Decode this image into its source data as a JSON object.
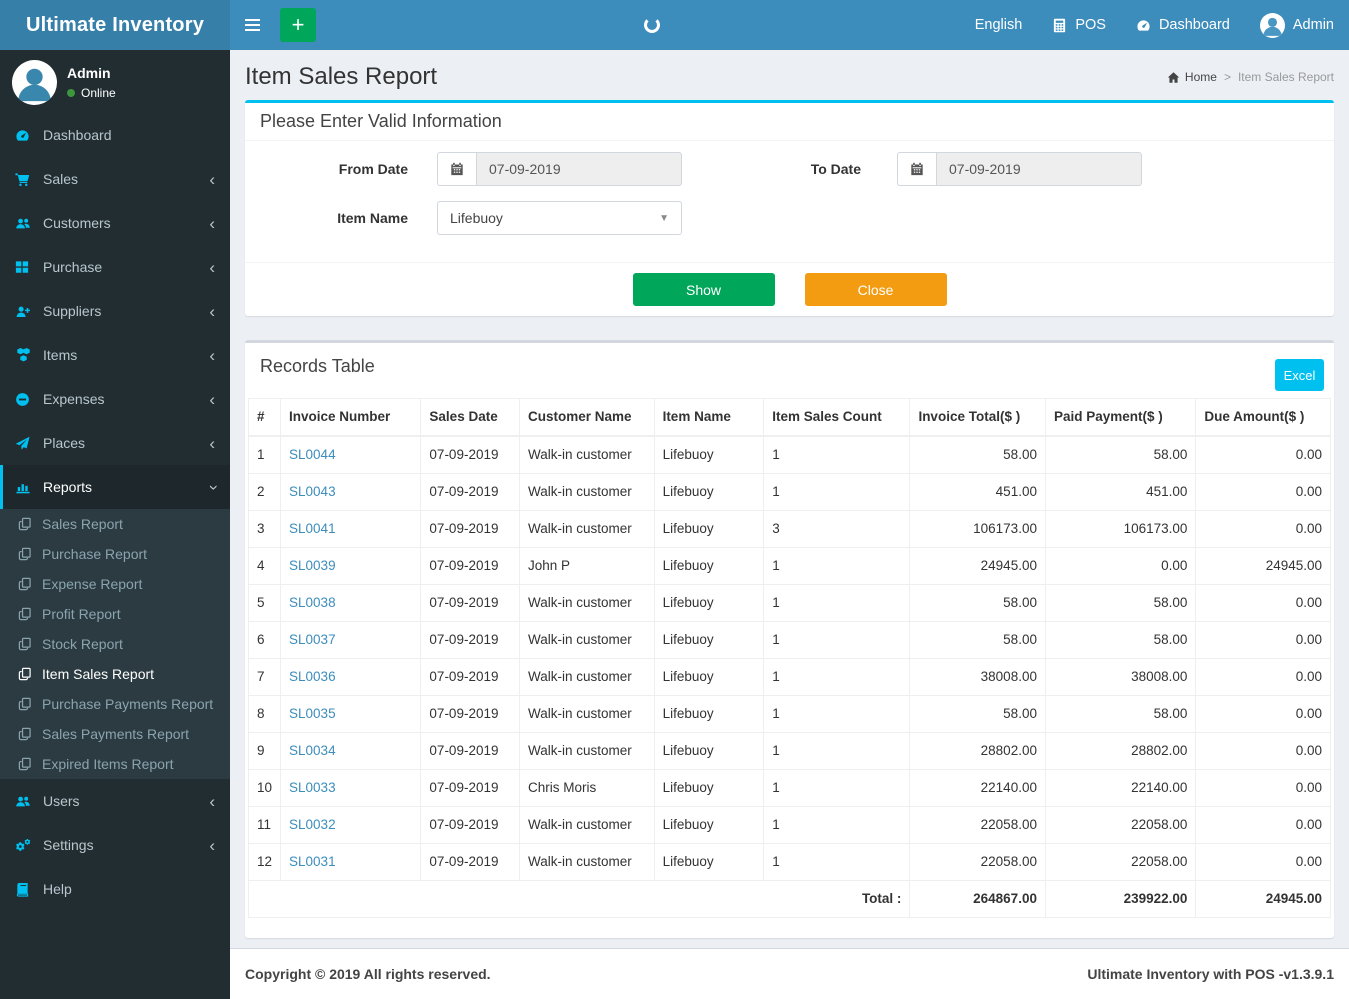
{
  "app": {
    "title": "Ultimate Inventory"
  },
  "topnav": {
    "add_button": "+",
    "links": [
      {
        "id": "language",
        "label": "English",
        "icon": null
      },
      {
        "id": "pos",
        "label": "POS",
        "icon": "calculator"
      },
      {
        "id": "dashboard",
        "label": "Dashboard",
        "icon": "speedometer"
      },
      {
        "id": "admin",
        "label": "Admin",
        "icon": "avatar"
      }
    ]
  },
  "sidebar": {
    "user": {
      "name": "Admin",
      "status": "Online"
    },
    "menu": [
      {
        "label": "Dashboard",
        "icon": "speedometer",
        "expandable": false
      },
      {
        "label": "Sales",
        "icon": "cart",
        "expandable": true
      },
      {
        "label": "Customers",
        "icon": "users",
        "expandable": true
      },
      {
        "label": "Purchase",
        "icon": "grid",
        "expandable": true
      },
      {
        "label": "Suppliers",
        "icon": "user-plus",
        "expandable": true
      },
      {
        "label": "Items",
        "icon": "cubes",
        "expandable": true
      },
      {
        "label": "Expenses",
        "icon": "minus-circle",
        "expandable": true
      },
      {
        "label": "Places",
        "icon": "paper-plane",
        "expandable": true
      },
      {
        "label": "Reports",
        "icon": "bar-chart",
        "expandable": true,
        "expanded": true,
        "active": true,
        "submenu": [
          {
            "label": "Sales Report"
          },
          {
            "label": "Purchase Report"
          },
          {
            "label": "Expense Report"
          },
          {
            "label": "Profit Report"
          },
          {
            "label": "Stock Report"
          },
          {
            "label": "Item Sales Report",
            "active": true
          },
          {
            "label": "Purchase Payments Report"
          },
          {
            "label": "Sales Payments Report"
          },
          {
            "label": "Expired Items Report"
          }
        ]
      },
      {
        "label": "Users",
        "icon": "users",
        "expandable": true
      },
      {
        "label": "Settings",
        "icon": "gears",
        "expandable": true
      },
      {
        "label": "Help",
        "icon": "book",
        "expandable": false
      }
    ]
  },
  "page": {
    "title": "Item Sales Report",
    "breadcrumb": {
      "home": "Home",
      "separator": ">",
      "current": "Item Sales Report"
    }
  },
  "filter": {
    "header": "Please Enter Valid Information",
    "from_date": {
      "label": "From Date",
      "value": "07-09-2019"
    },
    "to_date": {
      "label": "To Date",
      "value": "07-09-2019"
    },
    "item_name": {
      "label": "Item Name",
      "value": "Lifebuoy"
    },
    "buttons": {
      "show": "Show",
      "close": "Close"
    }
  },
  "records": {
    "header": "Records Table",
    "excel_button": "Excel",
    "columns": [
      "#",
      "Invoice Number",
      "Sales Date",
      "Customer Name",
      "Item Name",
      "Item Sales Count",
      "Invoice Total($ )",
      "Paid Payment($ )",
      "Due Amount($ )"
    ],
    "rows": [
      [
        "1",
        "SL0044",
        "07-09-2019",
        "Walk-in customer",
        "Lifebuoy",
        "1",
        "58.00",
        "58.00",
        "0.00"
      ],
      [
        "2",
        "SL0043",
        "07-09-2019",
        "Walk-in customer",
        "Lifebuoy",
        "1",
        "451.00",
        "451.00",
        "0.00"
      ],
      [
        "3",
        "SL0041",
        "07-09-2019",
        "Walk-in customer",
        "Lifebuoy",
        "3",
        "106173.00",
        "106173.00",
        "0.00"
      ],
      [
        "4",
        "SL0039",
        "07-09-2019",
        "John P",
        "Lifebuoy",
        "1",
        "24945.00",
        "0.00",
        "24945.00"
      ],
      [
        "5",
        "SL0038",
        "07-09-2019",
        "Walk-in customer",
        "Lifebuoy",
        "1",
        "58.00",
        "58.00",
        "0.00"
      ],
      [
        "6",
        "SL0037",
        "07-09-2019",
        "Walk-in customer",
        "Lifebuoy",
        "1",
        "58.00",
        "58.00",
        "0.00"
      ],
      [
        "7",
        "SL0036",
        "07-09-2019",
        "Walk-in customer",
        "Lifebuoy",
        "1",
        "38008.00",
        "38008.00",
        "0.00"
      ],
      [
        "8",
        "SL0035",
        "07-09-2019",
        "Walk-in customer",
        "Lifebuoy",
        "1",
        "58.00",
        "58.00",
        "0.00"
      ],
      [
        "9",
        "SL0034",
        "07-09-2019",
        "Walk-in customer",
        "Lifebuoy",
        "1",
        "28802.00",
        "28802.00",
        "0.00"
      ],
      [
        "10",
        "SL0033",
        "07-09-2019",
        "Chris Moris",
        "Lifebuoy",
        "1",
        "22140.00",
        "22140.00",
        "0.00"
      ],
      [
        "11",
        "SL0032",
        "07-09-2019",
        "Walk-in customer",
        "Lifebuoy",
        "1",
        "22058.00",
        "22058.00",
        "0.00"
      ],
      [
        "12",
        "SL0031",
        "07-09-2019",
        "Walk-in customer",
        "Lifebuoy",
        "1",
        "22058.00",
        "22058.00",
        "0.00"
      ]
    ],
    "total": {
      "label": "Total :",
      "invoice_total": "264867.00",
      "paid_payment": "239922.00",
      "due_amount": "24945.00"
    }
  },
  "footer": {
    "copyright": "Copyright © 2019 All rights reserved.",
    "version": "Ultimate Inventory with POS -v1.3.9.1"
  },
  "colors": {
    "navbar": "#3c8dbc",
    "logo": "#367fa9",
    "sidebar": "#222d32",
    "accent": "#00c0ef",
    "green": "#00a65a",
    "orange": "#f39c12",
    "link": "#3c8dbc"
  }
}
